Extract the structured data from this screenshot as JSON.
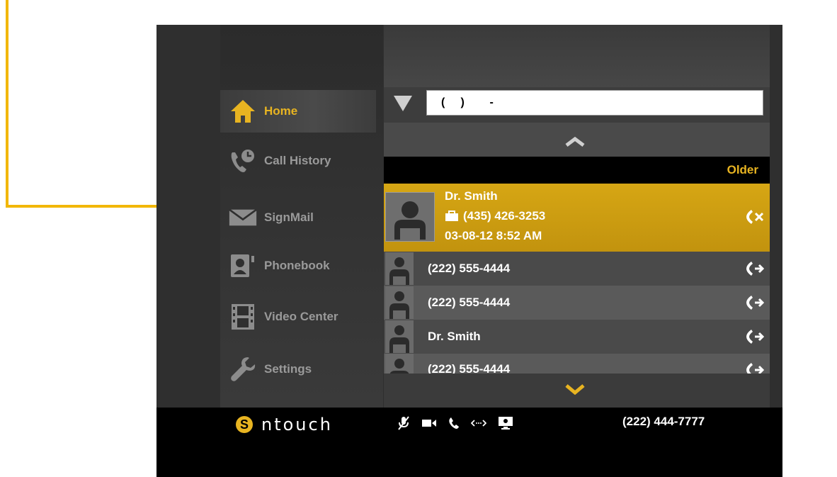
{
  "sidebar": {
    "items": [
      {
        "label": "Home",
        "icon": "home-icon",
        "active": true
      },
      {
        "label": "Call History",
        "icon": "call-history-icon",
        "active": false
      },
      {
        "label": "SignMail",
        "icon": "envelope-icon",
        "active": false
      },
      {
        "label": "Phonebook",
        "icon": "phonebook-icon",
        "active": false
      },
      {
        "label": "Video Center",
        "icon": "film-icon",
        "active": false
      },
      {
        "label": "Settings",
        "icon": "wrench-icon",
        "active": false
      }
    ]
  },
  "dial": {
    "value": "(     )        -"
  },
  "history": {
    "filter_label": "Older",
    "selected": {
      "name": "Dr. Smith",
      "phone": "(435) 426-3253",
      "datetime": "03-08-12  8:52 AM"
    },
    "rows": [
      {
        "text": "(222) 555-4444"
      },
      {
        "text": "(222) 555-4444"
      },
      {
        "text": "Dr. Smith"
      },
      {
        "text": "(222) 555-4444"
      }
    ]
  },
  "statusbar": {
    "brand": "ntouch",
    "brand_mark": "S",
    "own_number": "(222) 444-7777"
  },
  "colors": {
    "accent": "#e8b421",
    "selected_row": "#c99a10",
    "callout": "#f2b705"
  }
}
